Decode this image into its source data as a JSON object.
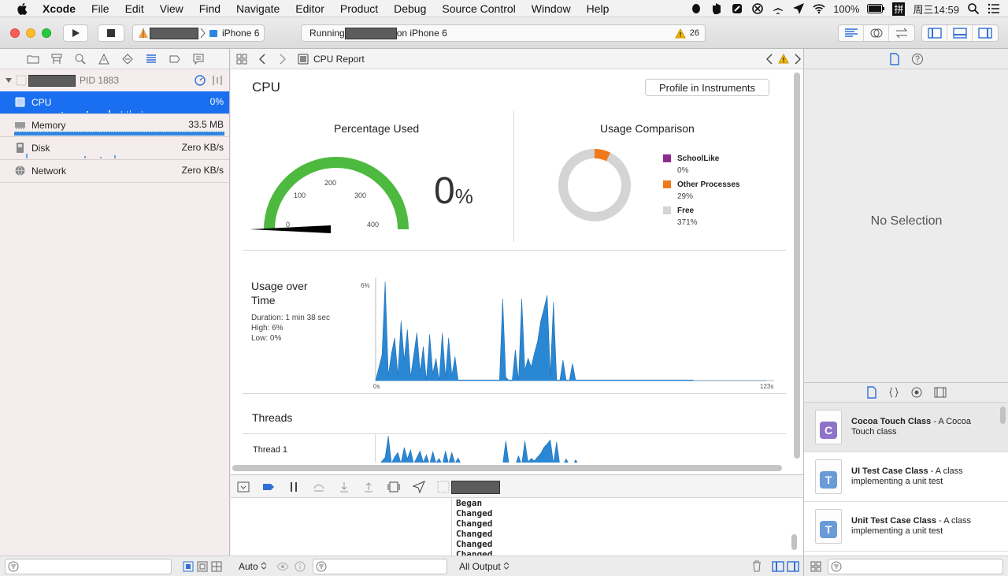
{
  "menubar": {
    "app_name": "Xcode",
    "menus": [
      "File",
      "Edit",
      "View",
      "Find",
      "Navigate",
      "Editor",
      "Product",
      "Debug",
      "Source Control",
      "Window",
      "Help"
    ],
    "battery": "100%",
    "input_method": "拼",
    "clock": "周三14:59"
  },
  "toolbar": {
    "device": "iPhone 6",
    "status_prefix": "Running",
    "status_suffix": "on iPhone 6",
    "warning_count": "26"
  },
  "navigator": {
    "process_label": "PID 1883",
    "gauges": [
      {
        "name": "CPU",
        "value": "0%"
      },
      {
        "name": "Memory",
        "value": "33.5 MB"
      },
      {
        "name": "Disk",
        "value": "Zero KB/s"
      },
      {
        "name": "Network",
        "value": "Zero KB/s"
      }
    ]
  },
  "jumpbar": {
    "title": "CPU Report"
  },
  "report": {
    "title": "CPU",
    "profile_button": "Profile in Instruments",
    "percentage_used": {
      "title": "Percentage Used",
      "value": "0",
      "unit": "%",
      "gauge_ticks": [
        "0",
        "100",
        "200",
        "300",
        "400"
      ],
      "gauge_value": 0,
      "gauge_max": 400
    },
    "usage_comparison": {
      "title": "Usage Comparison",
      "legend": [
        {
          "name": "SchoolLike",
          "value": "0%",
          "color": "#8e2b8f"
        },
        {
          "name": "Other Processes",
          "value": "29%",
          "color": "#f07a1a"
        },
        {
          "name": "Free",
          "value": "371%",
          "color": "#d4d4d4"
        }
      ]
    },
    "usage_over_time": {
      "title_line1": "Usage over",
      "title_line2": "Time",
      "duration": "Duration: 1 min 38 sec",
      "high": "High: 6%",
      "low": "Low: 0%",
      "y_label": "6%",
      "x_start": "0s",
      "x_end": "123s"
    },
    "threads": {
      "title": "Threads",
      "thread_label": "Thread 1"
    }
  },
  "chart_data": [
    {
      "type": "pie",
      "categories": [
        "SchoolLike",
        "Other Processes",
        "Free"
      ],
      "values": [
        0,
        29,
        371
      ],
      "colors": [
        "#8e2b8f",
        "#f07a1a",
        "#d4d4d4"
      ]
    },
    {
      "type": "area",
      "y_max": 6,
      "x_range": [
        0,
        123
      ],
      "x": [
        0,
        2,
        3,
        4,
        5,
        6,
        7,
        8,
        9,
        10,
        11,
        12,
        13,
        14,
        15,
        16,
        17,
        18,
        19,
        20,
        21,
        22,
        23,
        24,
        25,
        26,
        27,
        28,
        29,
        30,
        31,
        32,
        33,
        34,
        35,
        36,
        37,
        38,
        39,
        40,
        41,
        42,
        43,
        44,
        45,
        46,
        47,
        48,
        49,
        50,
        51,
        52,
        53,
        54,
        55,
        56,
        57,
        58,
        59,
        60,
        61,
        62,
        63,
        64,
        65,
        66,
        67,
        68,
        69,
        70,
        71,
        72,
        73,
        74,
        75,
        76,
        77,
        78,
        80,
        90,
        100,
        110,
        123
      ],
      "values": [
        0,
        1.5,
        5.8,
        0.3,
        1.6,
        2.5,
        0.3,
        3.5,
        1.2,
        3.0,
        0.2,
        1.5,
        2.8,
        0.5,
        2.0,
        0,
        2.7,
        0.4,
        1.3,
        0,
        2.8,
        0.2,
        2.5,
        0.3,
        1.4,
        0,
        0,
        0,
        0,
        0,
        0,
        0,
        0,
        0,
        0,
        0,
        0,
        0,
        0,
        4.8,
        0.2,
        0,
        0,
        1.8,
        0,
        4.8,
        0.6,
        1.3,
        0.8,
        1.6,
        2.3,
        3.5,
        4.2,
        5.0,
        0.3,
        4.6,
        0,
        0,
        1.2,
        0,
        0,
        1.0,
        0,
        0,
        0,
        0,
        0,
        0,
        0,
        0,
        0,
        0,
        0,
        0,
        0,
        0,
        0,
        0,
        0,
        0,
        0,
        0,
        0
      ]
    }
  ],
  "inspector": {
    "empty_text": "No Selection"
  },
  "library": [
    {
      "letter": "C",
      "color": "#8e73c8",
      "title": "Cocoa Touch Class",
      "desc": "A Cocoa Touch class"
    },
    {
      "letter": "T",
      "color": "#6a9ad8",
      "title": "UI Test Case Class",
      "desc": "A class implementing a unit test"
    },
    {
      "letter": "T",
      "color": "#6a9ad8",
      "title": "Unit Test Case Class",
      "desc": "A class implementing a unit test"
    }
  ],
  "console": {
    "lines": [
      "Began",
      "Changed",
      "Changed",
      "Changed",
      "Changed",
      "Changed"
    ],
    "output_filter": "All Output",
    "vars_mode": "Auto"
  }
}
